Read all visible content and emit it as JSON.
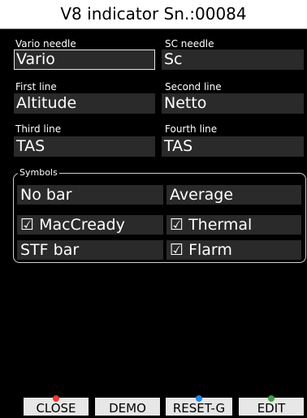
{
  "title": "V8 indicator Sn.:00084",
  "fields": {
    "vario_needle": {
      "label": "Vario needle",
      "value": "Vario"
    },
    "sc_needle": {
      "label": "SC needle",
      "value": "Sc"
    },
    "first_line": {
      "label": "First line",
      "value": "Altitude"
    },
    "second_line": {
      "label": "Second line",
      "value": "Netto"
    },
    "third_line": {
      "label": "Third line",
      "value": "TAS"
    },
    "fourth_line": {
      "label": "Fourth line",
      "value": "TAS"
    }
  },
  "symbols": {
    "title": "Symbols",
    "items": [
      "No bar",
      "Average",
      "☑ MacCready",
      "☑ Thermal",
      "STF bar",
      "☑ Flarm"
    ]
  },
  "buttons": {
    "close": "CLOSE",
    "demo": "DEMO",
    "reset": "RESET-G",
    "edit": "EDIT"
  },
  "colors": {
    "close_icon": "#e53935",
    "reset_icon": "#1e88e5",
    "edit_icon": "#43a047"
  }
}
